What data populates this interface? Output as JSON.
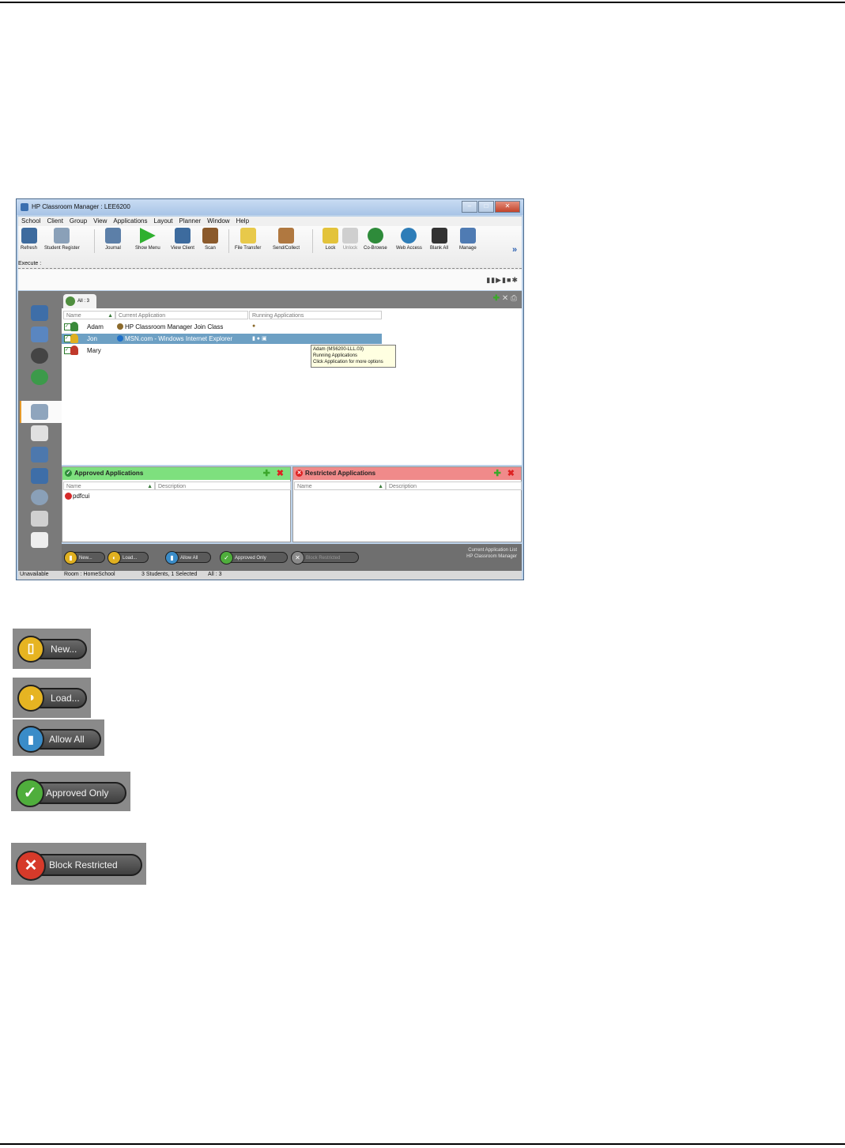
{
  "window": {
    "title": "HP Classroom Manager : LEE6200",
    "buttons": {
      "minimize": "–",
      "maximize": "□",
      "close": "✕"
    }
  },
  "menu": [
    "School",
    "Client",
    "Group",
    "View",
    "Applications",
    "Layout",
    "Planner",
    "Window",
    "Help"
  ],
  "toolbar": {
    "items": [
      "Refresh",
      "Student Register",
      "Journal",
      "Show Menu",
      "View Client",
      "Scan",
      "File Transfer",
      "Send/Collect",
      "Lock",
      "Unlock",
      "Co-Browse",
      "Web Access",
      "Blank All",
      "Manage"
    ],
    "overflow": "»"
  },
  "execute_label": "Execute :",
  "tab": {
    "label": "All : 3"
  },
  "grid": {
    "columns": [
      "Name",
      "Current Application",
      "Running Applications"
    ],
    "rows": [
      {
        "name": "Adam",
        "app": "HP Classroom Manager Join Class"
      },
      {
        "name": "Jon",
        "app": "MSN.com - Windows Internet Explorer"
      },
      {
        "name": "Mary",
        "app": ""
      }
    ],
    "tooltip": [
      "Adam (MS6200-LLL.03)",
      "Running Applications",
      "Click Application for more options"
    ]
  },
  "approved": {
    "title": "Approved Applications",
    "columns": [
      "Name",
      "Description"
    ],
    "items": [
      "pdfcui"
    ],
    "color": "#7ee07e"
  },
  "restricted": {
    "title": "Restricted Applications",
    "columns": [
      "Name",
      "Description"
    ],
    "color": "#f08a8a"
  },
  "bottom_buttons": {
    "new": "New...",
    "load": "Load...",
    "allow_all": "Allow All",
    "approved_only": "Approved Only",
    "block_restricted": "Block Restricted"
  },
  "bottom_info": [
    "Current Application List",
    "HP Classroom Manager"
  ],
  "status": {
    "state": "Unavailable",
    "room": "Room : HomeSchool",
    "students": "3 Students, 1 Selected",
    "all": "All : 3"
  },
  "large_buttons": {
    "new": "New...",
    "load": "Load...",
    "allow_all": "Allow All",
    "approved_only": "Approved Only",
    "block_restricted": "Block Restricted"
  }
}
